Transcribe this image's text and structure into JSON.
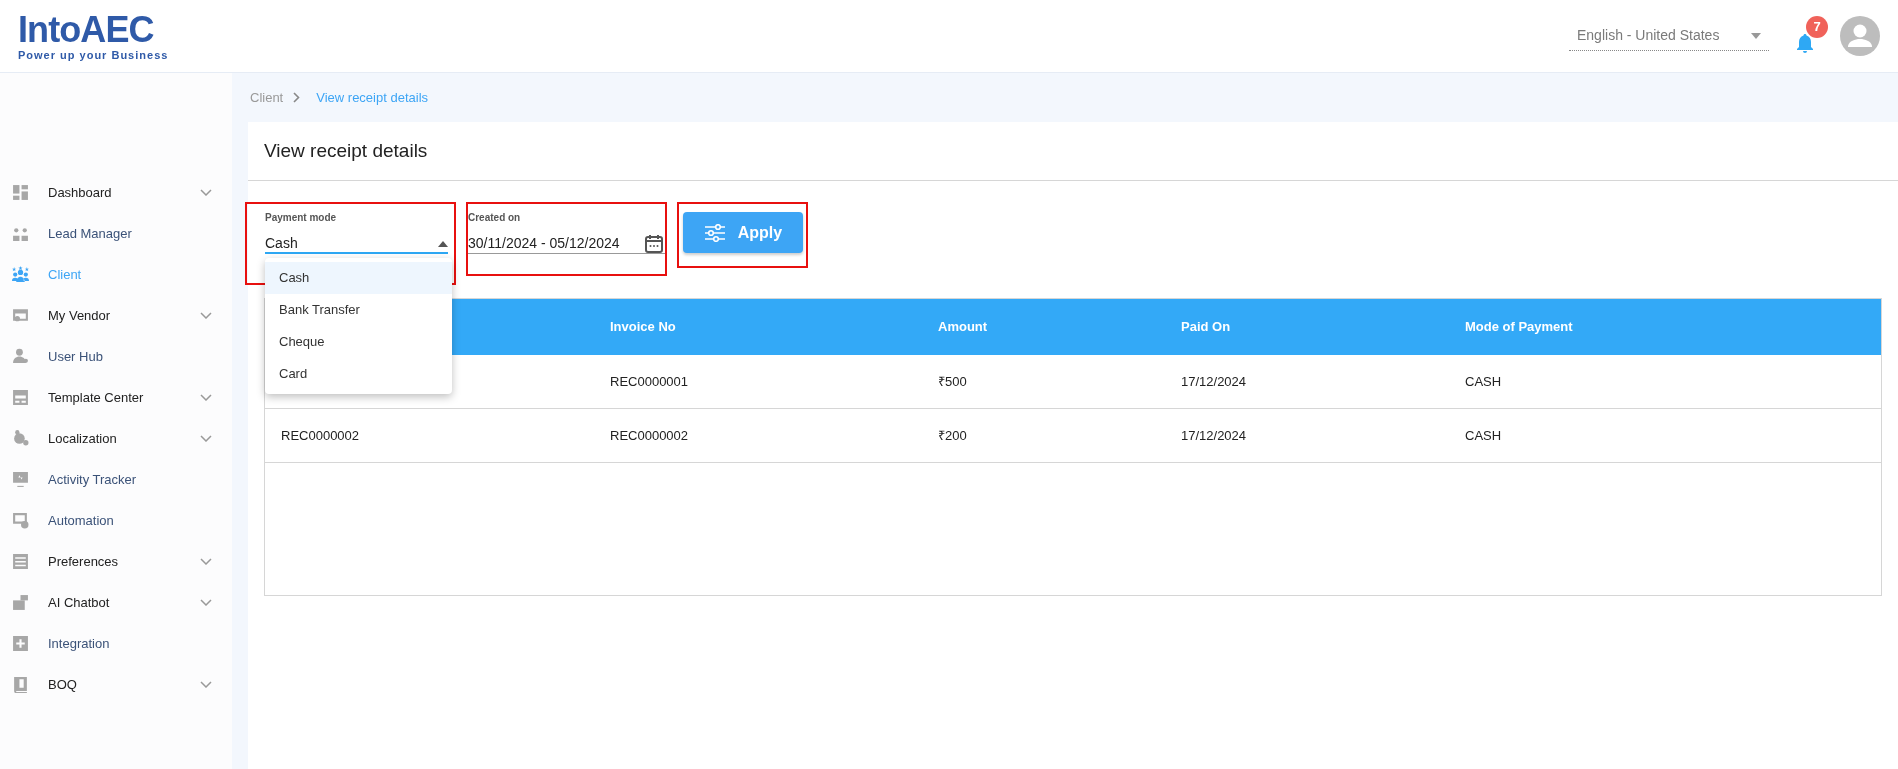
{
  "header": {
    "logo": {
      "brand_text": "IntoAEC",
      "tagline": "Power up your Business"
    },
    "language": {
      "value": "English - United States"
    },
    "notifications": {
      "count": "7"
    }
  },
  "sidebar": {
    "items": [
      {
        "label": "Dashboard",
        "expandable": true,
        "selected": false
      },
      {
        "label": "Lead Manager",
        "expandable": false,
        "selected": false
      },
      {
        "label": "Client",
        "expandable": false,
        "selected": true
      },
      {
        "label": "My Vendor",
        "expandable": true,
        "selected": false
      },
      {
        "label": "User Hub",
        "expandable": false,
        "selected": false
      },
      {
        "label": "Template Center",
        "expandable": true,
        "selected": false
      },
      {
        "label": "Localization",
        "expandable": true,
        "selected": false
      },
      {
        "label": "Activity Tracker",
        "expandable": false,
        "selected": false
      },
      {
        "label": "Automation",
        "expandable": false,
        "selected": false
      },
      {
        "label": "Preferences",
        "expandable": true,
        "selected": false
      },
      {
        "label": "AI Chatbot",
        "expandable": true,
        "selected": false
      },
      {
        "label": "Integration",
        "expandable": false,
        "selected": false
      },
      {
        "label": "BOQ",
        "expandable": true,
        "selected": false
      }
    ]
  },
  "breadcrumb": [
    {
      "label": "Client",
      "current": false
    },
    {
      "label": "View receipt details",
      "current": true
    }
  ],
  "page_title": "View receipt details",
  "filters": {
    "payment_mode": {
      "label": "Payment mode",
      "value": "Cash",
      "expanded": true,
      "highlighted": true,
      "options": [
        {
          "label": "Cash",
          "selected": true
        },
        {
          "label": "Bank Transfer",
          "selected": false
        },
        {
          "label": "Cheque",
          "selected": false
        },
        {
          "label": "Card",
          "selected": false
        }
      ]
    },
    "created_on": {
      "label": "Created on",
      "value": "30/11/2024 - 05/12/2024",
      "highlighted": true
    },
    "apply_button": {
      "label": "Apply",
      "highlighted": true
    }
  },
  "table": {
    "columns": [
      "Invoice No",
      "Amount",
      "Paid On",
      "Mode of Payment"
    ],
    "rows": [
      {
        "cells": [
          "REC0000001",
          "₹500",
          "17/12/2024",
          "CASH"
        ]
      },
      {
        "column_1": "REC0000002",
        "cells": [
          "REC0000002",
          "₹200",
          "17/12/2024",
          "CASH"
        ]
      }
    ]
  }
}
